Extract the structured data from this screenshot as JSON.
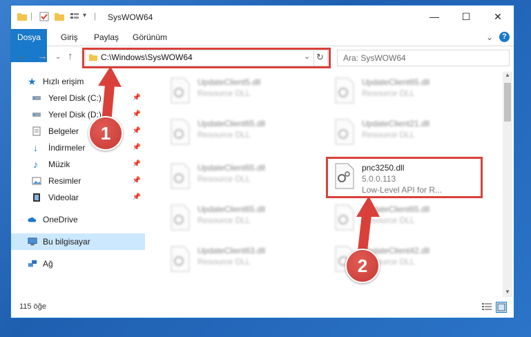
{
  "window": {
    "title": "SysWOW64",
    "minimize": "—",
    "maximize": "☐",
    "close": "✕"
  },
  "ribbon": {
    "tabs": [
      "Dosya",
      "Giriş",
      "Paylaş",
      "Görünüm"
    ],
    "expand": "⌄",
    "help": "?"
  },
  "address": {
    "path": "C:\\Windows\\SysWOW64",
    "search_placeholder": "Ara: SysWOW64"
  },
  "sidebar": {
    "quick_access": "Hızlı erişim",
    "items": [
      {
        "label": "Yerel Disk (C:)",
        "pinned": true
      },
      {
        "label": "Yerel Disk (D:)",
        "pinned": true
      },
      {
        "label": "Belgeler",
        "pinned": true
      },
      {
        "label": "İndirmeler",
        "pinned": true
      },
      {
        "label": "Müzik",
        "pinned": true
      },
      {
        "label": "Resimler",
        "pinned": true
      },
      {
        "label": "Videolar",
        "pinned": true
      }
    ],
    "onedrive": "OneDrive",
    "this_pc": "Bu bilgisayar",
    "network": "Ağ"
  },
  "files": {
    "left": [
      {
        "name": "UpdateClient5.dll",
        "desc": "Resource DLL"
      },
      {
        "name": "UpdateClient65.dll",
        "desc": "Resource DLL"
      },
      {
        "name": "UpdateClient65.dll",
        "desc": "Resource DLL"
      },
      {
        "name": "UpdateClient65.dll",
        "desc": "Resource DLL"
      },
      {
        "name": "UpdateClient63.dll",
        "desc": "Resource DLL"
      }
    ],
    "right": [
      {
        "name": "UpdateClient65.dll",
        "desc": "Resource DLL"
      },
      {
        "name": "UpdateClient21.dll",
        "desc": "Resource DLL"
      },
      {
        "name": "pnc3250.dll",
        "version": "5.0.0.113",
        "desc": "Low-Level API for R..."
      },
      {
        "name": "UpdateClient65.dll",
        "desc": "Resource DLL"
      },
      {
        "name": "UpdateClient42.dll",
        "desc": "Resource DLL"
      }
    ]
  },
  "status": {
    "count": "115 öğe"
  },
  "callouts": [
    "1",
    "2"
  ],
  "colors": {
    "accent": "#1979ca",
    "highlight": "#d9403a",
    "selected": "#cce8ff"
  }
}
